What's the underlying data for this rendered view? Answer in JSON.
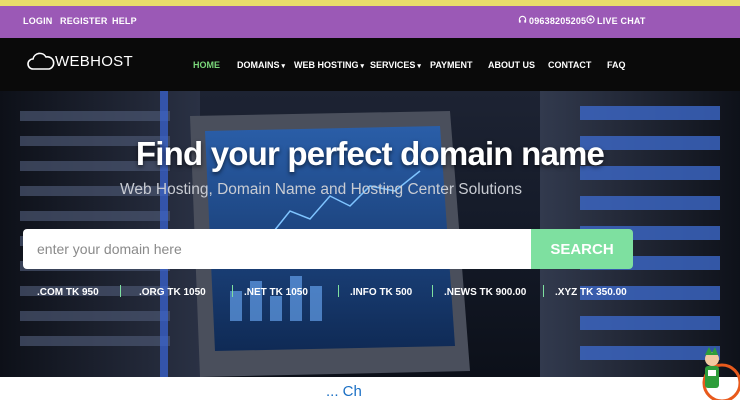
{
  "topbar": {
    "login": "LOGIN",
    "register": "REGISTER",
    "help": "HELP",
    "phone": "09638205205",
    "phone_icon": "headset-icon",
    "live_chat": "LIVE CHAT",
    "chat_icon": "chat-icon"
  },
  "brand": {
    "logo_text": "WEBHOST",
    "logo_icon": "cloud-icon"
  },
  "nav": {
    "items": [
      {
        "label": "HOME"
      },
      {
        "label": "DOMAINS"
      },
      {
        "label": "WEB HOSTING"
      },
      {
        "label": "SERVICES"
      },
      {
        "label": "PAYMENT"
      },
      {
        "label": "ABOUT US"
      },
      {
        "label": "CONTACT"
      },
      {
        "label": "FAQ"
      }
    ]
  },
  "hero": {
    "title": "Find your perfect domain name",
    "subtitle": "Web Hosting, Domain Name and Hosting Center Solutions",
    "search_placeholder": "enter your domain here",
    "search_button": "SEARCH",
    "prices": [
      {
        "label": ".COM TK 950"
      },
      {
        "label": ".ORG TK 1050"
      },
      {
        "label": ".NET TK 1050"
      },
      {
        "label": ".INFO TK 500"
      },
      {
        "label": ".NEWS TK 900.00"
      },
      {
        "label": ".XYZ TK 350.00"
      }
    ]
  },
  "bottom": {
    "text": "... Ch"
  },
  "colors": {
    "topbar": "#9b59b6",
    "accent": "#7ee0a0",
    "nav_active": "#7ad77a",
    "navbar": "#0a0a0a"
  }
}
